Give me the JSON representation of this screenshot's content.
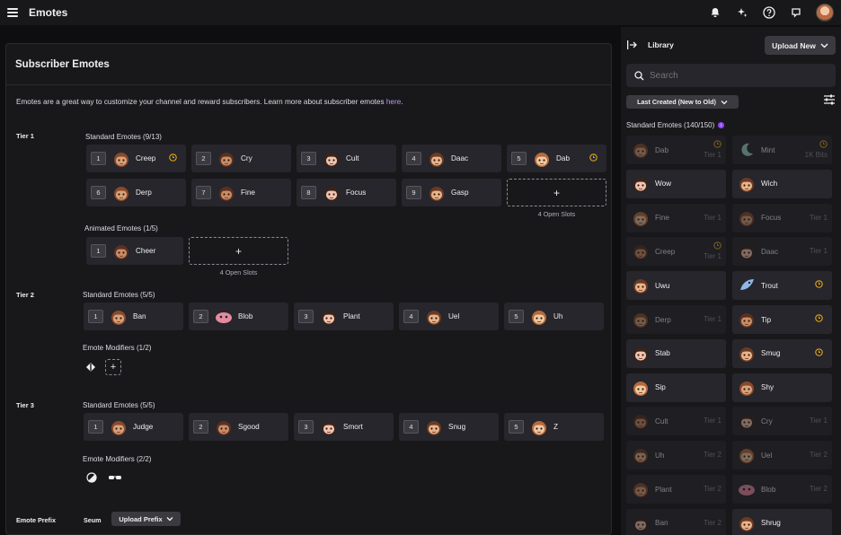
{
  "topbar": {
    "title": "Emotes"
  },
  "main": {
    "heading": "Subscriber Emotes",
    "description": "Emotes are a great way to customize your channel and reward subscribers. Learn more about subscriber emotes ",
    "description_link": "here",
    "description_end": ".",
    "tier1": {
      "label": "Tier 1",
      "standard_label": "Standard Emotes (9/13)",
      "standard": [
        {
          "num": "1",
          "name": "Creep"
        },
        {
          "num": "2",
          "name": "Cry"
        },
        {
          "num": "3",
          "name": "Cult"
        },
        {
          "num": "4",
          "name": "Daac"
        },
        {
          "num": "5",
          "name": "Dab"
        },
        {
          "num": "6",
          "name": "Derp"
        },
        {
          "num": "7",
          "name": "Fine"
        },
        {
          "num": "8",
          "name": "Focus"
        },
        {
          "num": "9",
          "name": "Gasp"
        }
      ],
      "open_slots": "4 Open Slots",
      "animated_label": "Animated Emotes (1/5)",
      "animated": [
        {
          "num": "1",
          "name": "Cheer"
        }
      ],
      "animated_open_slots": "4 Open Slots"
    },
    "tier2": {
      "label": "Tier 2",
      "standard_label": "Standard Emotes (5/5)",
      "standard": [
        {
          "num": "1",
          "name": "Ban"
        },
        {
          "num": "2",
          "name": "Blob"
        },
        {
          "num": "3",
          "name": "Plant"
        },
        {
          "num": "4",
          "name": "Uel"
        },
        {
          "num": "5",
          "name": "Uh"
        }
      ],
      "modifiers_label": "Emote Modifiers (1/2)"
    },
    "tier3": {
      "label": "Tier 3",
      "standard_label": "Standard Emotes (5/5)",
      "standard": [
        {
          "num": "1",
          "name": "Judge"
        },
        {
          "num": "2",
          "name": "Sgood"
        },
        {
          "num": "3",
          "name": "Smort"
        },
        {
          "num": "4",
          "name": "Snug"
        },
        {
          "num": "5",
          "name": "Z"
        }
      ],
      "modifiers_label": "Emote Modifiers (2/2)"
    },
    "prefix": {
      "label": "Emote Prefix",
      "value": "Seum",
      "button": "Upload Prefix"
    }
  },
  "library": {
    "title": "Library",
    "upload_button": "Upload New",
    "search_placeholder": "Search",
    "sort_label": "Last Created (New to Old)",
    "section_label": "Standard Emotes (140/150)",
    "cards": [
      {
        "name": "Dab",
        "tier": "Tier 1"
      },
      {
        "name": "Mint",
        "tier": "1K Bits"
      },
      {
        "name": "Wow",
        "tier": ""
      },
      {
        "name": "Wich",
        "tier": ""
      },
      {
        "name": "Fine",
        "tier": "Tier 1"
      },
      {
        "name": "Focus",
        "tier": "Tier 1"
      },
      {
        "name": "Creep",
        "tier": "Tier 1"
      },
      {
        "name": "Daac",
        "tier": "Tier 1"
      },
      {
        "name": "Uwu",
        "tier": ""
      },
      {
        "name": "Trout",
        "tier": ""
      },
      {
        "name": "Derp",
        "tier": "Tier 1"
      },
      {
        "name": "Tip",
        "tier": ""
      },
      {
        "name": "Stab",
        "tier": ""
      },
      {
        "name": "Smug",
        "tier": ""
      },
      {
        "name": "Sip",
        "tier": ""
      },
      {
        "name": "Shy",
        "tier": ""
      },
      {
        "name": "Cult",
        "tier": "Tier 1"
      },
      {
        "name": "Cry",
        "tier": "Tier 1"
      },
      {
        "name": "Uh",
        "tier": "Tier 2"
      },
      {
        "name": "Uel",
        "tier": "Tier 2"
      },
      {
        "name": "Plant",
        "tier": "Tier 2"
      },
      {
        "name": "Blob",
        "tier": "Tier 2"
      },
      {
        "name": "Ban",
        "tier": "Tier 2"
      },
      {
        "name": "Shrug",
        "tier": ""
      }
    ]
  },
  "colors": {
    "accent": "#9147ff",
    "link": "#bf94ff",
    "pending": "#e6a817",
    "surface": "#26262c"
  }
}
